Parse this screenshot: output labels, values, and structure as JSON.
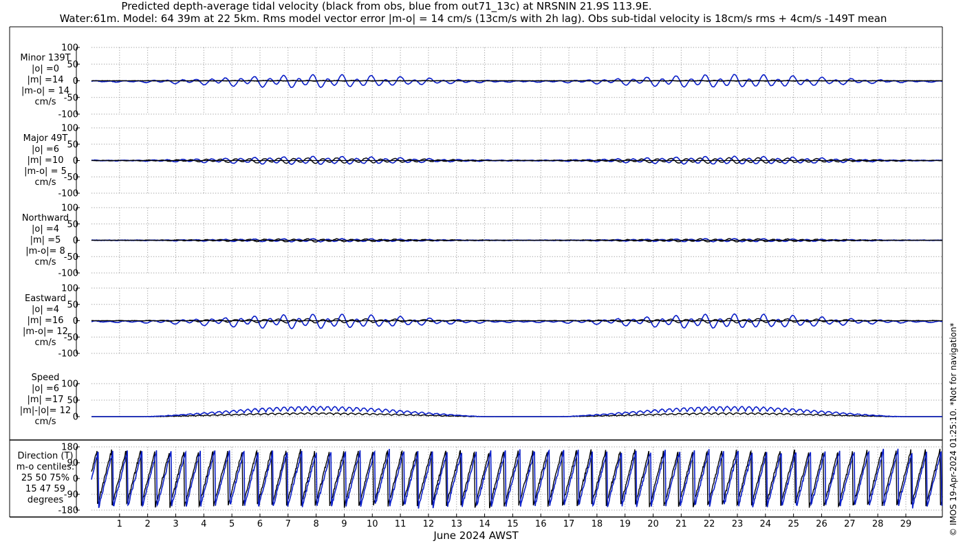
{
  "header": {
    "title_line1": "Predicted depth-average tidal velocity (black from obs, blue from out71_13c) at NRSNIN 21.9S 113.9E.",
    "title_line2": "Water:61m. Model: 64 39m at 22 5km. Rms model vector error |m-o| = 14 cm/s (13cm/s with 2h lag). Obs sub-tidal velocity is 18cm/s rms + 4cm/s -149T mean"
  },
  "footer": {
    "xlabel": "June 2024 AWST",
    "credit": "© IMOS 19-Apr-2024 01:25:10. *Not for navigation*"
  },
  "colors": {
    "obs": "#000000",
    "model": "#0a1ec8",
    "grid": "#9a9a9a",
    "axis": "#000000"
  },
  "chart_data": {
    "type": "line",
    "x_unit": "day of June 2024 (AWST)",
    "xlim": [
      0,
      30.3
    ],
    "xticks": [
      "1",
      "2",
      "3",
      "4",
      "5",
      "6",
      "7",
      "8",
      "9",
      "10",
      "11",
      "12",
      "13",
      "14",
      "15",
      "16",
      "17",
      "18",
      "19",
      "20",
      "21",
      "22",
      "23",
      "24",
      "25",
      "26",
      "27",
      "28",
      "29"
    ],
    "legend": [
      {
        "name": "obs",
        "description": "black from obs",
        "color": "#000000"
      },
      {
        "name": "model",
        "description": "blue from out71_13c",
        "color": "#0a1ec8"
      }
    ],
    "panels": [
      {
        "id": "minor",
        "label_lines": [
          "Minor 139T",
          "|o| =0",
          "|m| =14",
          "|m-o| = 14",
          "cm/s"
        ],
        "ylim": [
          -100,
          100
        ],
        "yticks": [
          "100",
          "50",
          "0",
          "-50",
          "-100"
        ],
        "grid": true,
        "series": [
          {
            "name": "obs",
            "diurnal_amplitude": 0,
            "semidiurnal_amplitude": 1,
            "offset": 0
          },
          {
            "name": "model",
            "diurnal_amplitude": 7,
            "semidiurnal_amplitude": 14,
            "offset": -2
          }
        ]
      },
      {
        "id": "major",
        "label_lines": [
          "Major 49T",
          "|o| =6",
          "|m| =10",
          "|m-o| = 5",
          "cm/s"
        ],
        "ylim": [
          -100,
          100
        ],
        "yticks": [
          "100",
          "50",
          "0",
          "-50",
          "-100"
        ],
        "grid": true,
        "series": [
          {
            "name": "obs",
            "diurnal_amplitude": 2,
            "semidiurnal_amplitude": 7,
            "offset": 0
          },
          {
            "name": "model",
            "diurnal_amplitude": 3,
            "semidiurnal_amplitude": 10,
            "offset": 0
          }
        ]
      },
      {
        "id": "north",
        "label_lines": [
          "Northward",
          "|o| =4",
          "|m| =5",
          "|m-o|= 8",
          "cm/s"
        ],
        "ylim": [
          -100,
          100
        ],
        "yticks": [
          "100",
          "50",
          "0",
          "-50",
          "-100"
        ],
        "grid": true,
        "series": [
          {
            "name": "obs",
            "diurnal_amplitude": 1,
            "semidiurnal_amplitude": 4,
            "offset": 0
          },
          {
            "name": "model",
            "diurnal_amplitude": 1,
            "semidiurnal_amplitude": 4,
            "offset": 0
          }
        ]
      },
      {
        "id": "east",
        "label_lines": [
          "Eastward",
          "|o| =4",
          "|m| =16",
          "|m-o|= 12",
          "cm/s"
        ],
        "ylim": [
          -100,
          100
        ],
        "yticks": [
          "100",
          "50",
          "0",
          "-50",
          "-100"
        ],
        "grid": true,
        "series": [
          {
            "name": "obs",
            "diurnal_amplitude": 2,
            "semidiurnal_amplitude": 5,
            "offset": 0
          },
          {
            "name": "model",
            "diurnal_amplitude": 8,
            "semidiurnal_amplitude": 16,
            "offset": -3
          }
        ]
      },
      {
        "id": "speed",
        "label_lines": [
          "Speed",
          "|o| =6",
          "|m| =17",
          "|m|-|o|= 12",
          "cm/s"
        ],
        "ylim": [
          0,
          100
        ],
        "yticks": [
          "100",
          "50",
          "0"
        ],
        "grid": true,
        "series": [
          {
            "name": "obs",
            "mean": 6,
            "variation": 6
          },
          {
            "name": "model",
            "mean": 17,
            "variation": 15
          }
        ]
      },
      {
        "id": "direction",
        "label_lines": [
          "Direction (T)",
          "m-o centiles:",
          "25  50  75%",
          "15  47  59",
          "degrees"
        ],
        "ylim": [
          -180,
          180
        ],
        "yticks": [
          "180",
          "90",
          "0",
          "-90",
          "-180"
        ],
        "grid": true,
        "series": [
          {
            "name": "obs",
            "units": "degrees True"
          },
          {
            "name": "model",
            "units": "degrees True"
          }
        ]
      }
    ],
    "tidal_periods_days": {
      "semidiurnal": 0.5175,
      "diurnal": 1.0758,
      "spring_neap": 14.77
    }
  }
}
